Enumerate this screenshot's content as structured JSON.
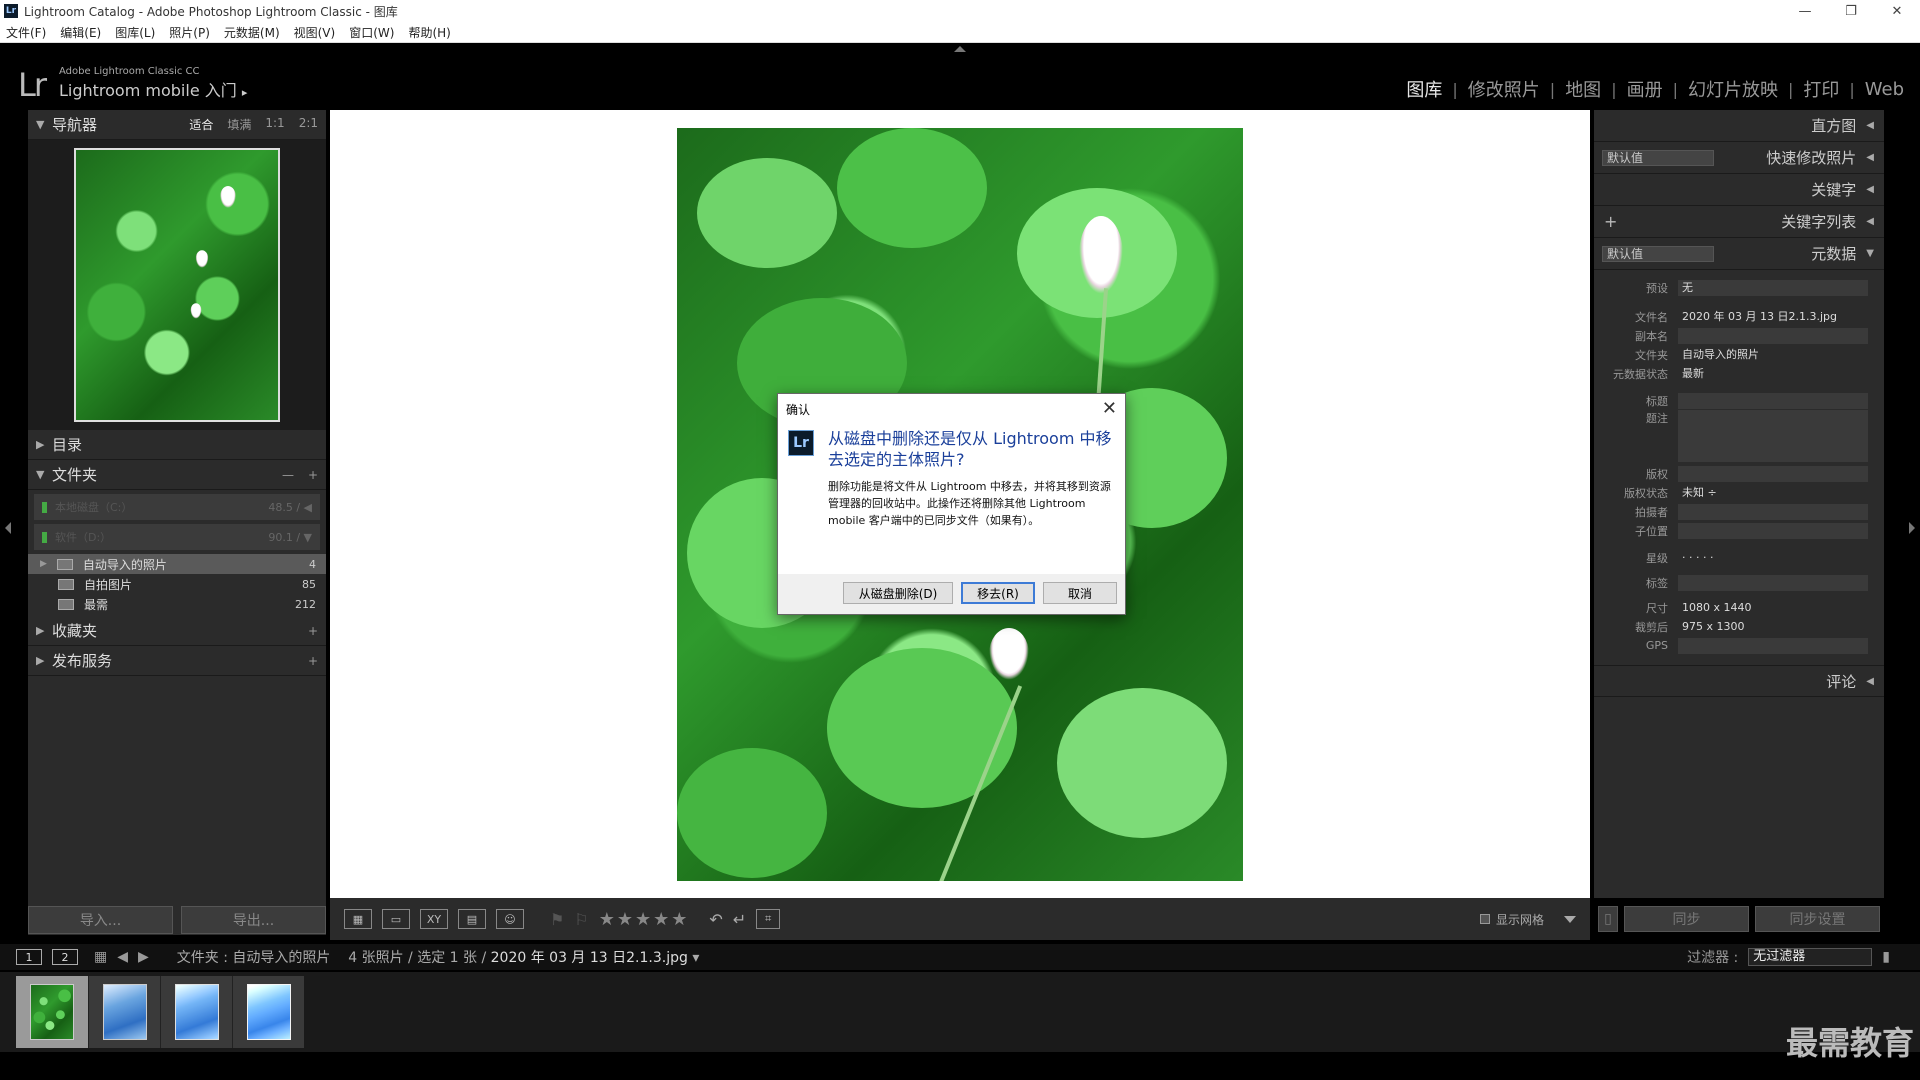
{
  "window": {
    "title": "Lightroom Catalog - Adobe Photoshop Lightroom Classic - 图库",
    "app_icon": "Lr"
  },
  "menu": [
    "文件(F)",
    "编辑(E)",
    "图库(L)",
    "照片(P)",
    "元数据(M)",
    "视图(V)",
    "窗口(W)",
    "帮助(H)"
  ],
  "identity": {
    "logo": "Lr",
    "line1": "Adobe Lightroom Classic CC",
    "line2": "Lightroom mobile 入门",
    "arrow": "▸"
  },
  "modules": [
    "图库",
    "修改照片",
    "地图",
    "画册",
    "幻灯片放映",
    "打印",
    "Web"
  ],
  "left": {
    "navigator": {
      "title": "导航器",
      "zoom": [
        "适合",
        "填满",
        "1:1",
        "2:1"
      ]
    },
    "catalog_title": "目录",
    "folders_title": "文件夹",
    "volumes": [
      {
        "name": "本地磁盘（C:）",
        "size": "48.5 /"
      },
      {
        "name": "软件（D:）",
        "size": "90.1 /"
      }
    ],
    "folders": [
      {
        "name": "自动导入的照片",
        "count": "4"
      },
      {
        "name": "自拍图片",
        "count": "85"
      },
      {
        "name": "最需",
        "count": "212"
      }
    ],
    "collections_title": "收藏夹",
    "publish_title": "发布服务",
    "import_label": "导入...",
    "export_label": "导出..."
  },
  "toolbar": {
    "stars": "★★★★★",
    "show_grid": "显示网格"
  },
  "right": {
    "histogram": "直方图",
    "quick_develop": "快速修改照片",
    "quick_preset": "默认值",
    "keywording": "关键字",
    "keyword_list": "关键字列表",
    "metadata": "元数据",
    "metadata_preset": "默认值",
    "comments": "评论",
    "sync_label": "同步",
    "sync_settings_label": "同步设置",
    "meta": {
      "preset_k": "预设",
      "preset_v": "无",
      "filename_k": "文件名",
      "filename_v": "2020 年 03 月 13 日2.1.3.jpg",
      "copy_k": "副本名",
      "copy_v": "",
      "folder_k": "文件夹",
      "folder_v": "自动导入的照片",
      "status_k": "元数据状态",
      "status_v": "最新",
      "title_k": "标题",
      "caption_k": "题注",
      "copyright_k": "版权",
      "copyright_status_k": "版权状态",
      "copyright_status_v": "未知 ÷",
      "creator_k": "拍摄者",
      "sublocation_k": "子位置",
      "rating_k": "星级",
      "rating_v": "· · · · ·",
      "label_k": "标签",
      "dims_k": "尺寸",
      "dims_v": "1080 x 1440",
      "crop_k": "裁剪后",
      "crop_v": "975 x 1300",
      "gps_k": "GPS"
    }
  },
  "filmbar": {
    "screen1": "1",
    "screen2": "2",
    "path_prefix": "文件夹 : 自动导入的照片",
    "path_count": "4 张照片 / 选定 1 张 /",
    "path_file": "2020 年 03 月 13 日2.1.3.jpg",
    "filter_label": "过滤器 :",
    "filter_value": "无过滤器"
  },
  "dialog": {
    "title": "确认",
    "icon": "Lr",
    "heading": "从磁盘中删除还是仅从 Lightroom 中移去选定的主体照片?",
    "body": "删除功能是将文件从 Lightroom 中移去，并将其移到资源管理器的回收站中。此操作还将删除其他 Lightroom mobile 客户端中的已同步文件（如果有）。",
    "btn_delete": "从磁盘删除(D)",
    "btn_remove": "移去(R)",
    "btn_cancel": "取消"
  },
  "watermark": "最需教育"
}
